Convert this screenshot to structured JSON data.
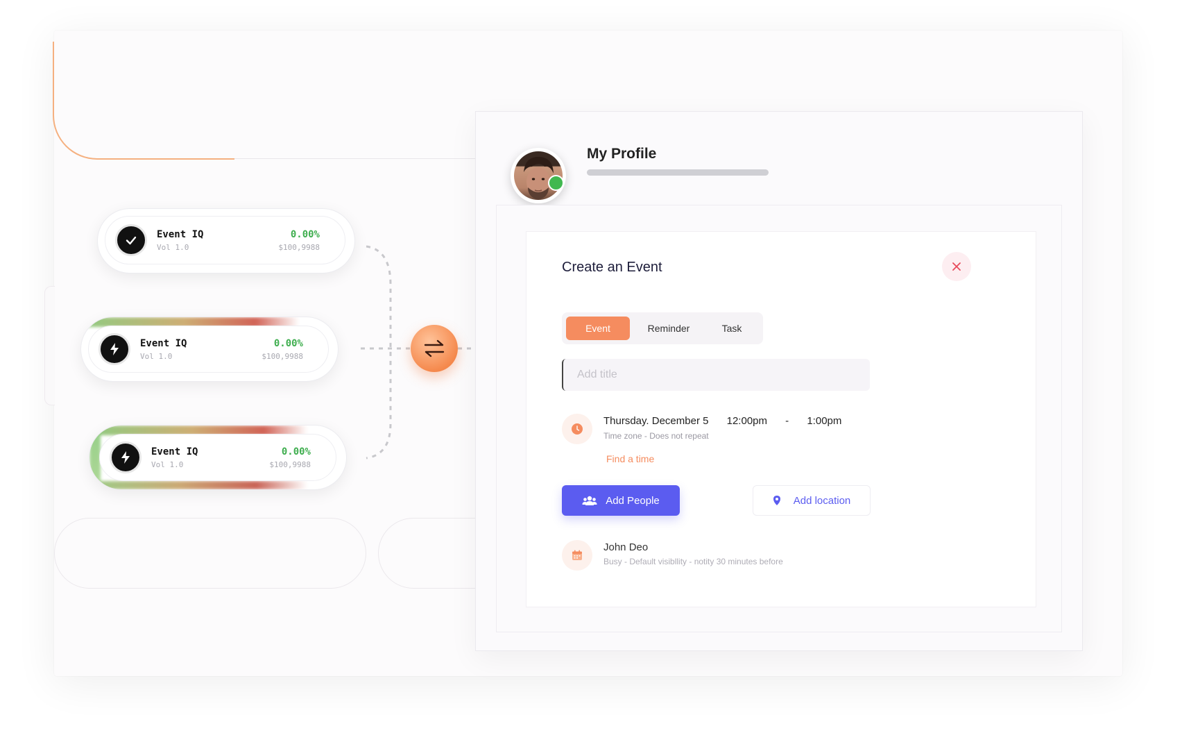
{
  "pills": [
    {
      "title": "Event IQ",
      "sub": "Vol 1.0",
      "pct": "0.00%",
      "amount": "$100,9988",
      "icon": "check-icon"
    },
    {
      "title": "Event IQ",
      "sub": "Vol 1.0",
      "pct": "0.00%",
      "amount": "$100,9988",
      "icon": "lightning-icon"
    },
    {
      "title": "Event IQ",
      "sub": "Vol 1.0",
      "pct": "0.00%",
      "amount": "$100,9988",
      "icon": "lightning-icon"
    }
  ],
  "profile": {
    "title": "My Profile",
    "status": "online"
  },
  "event_form": {
    "title": "Create an Event",
    "tabs": [
      "Event",
      "Reminder",
      "Task"
    ],
    "active_tab": "Event",
    "title_placeholder": "Add title",
    "date": "Thursday. December 5",
    "start_time": "12:00pm",
    "separator": "-",
    "end_time": "1:00pm",
    "time_meta": "Time zone - Does not repeat",
    "find_time": "Find a  time",
    "add_people": "Add People",
    "add_location": "Add location",
    "person_name": "John Deo",
    "person_meta": "Busy  - Default visibllity - notity 30 minutes before"
  },
  "colors": {
    "accent_orange": "#f58c5f",
    "accent_blue": "#5b5cf0",
    "positive_green": "#3fae4f",
    "close_red": "#e84b5c"
  }
}
